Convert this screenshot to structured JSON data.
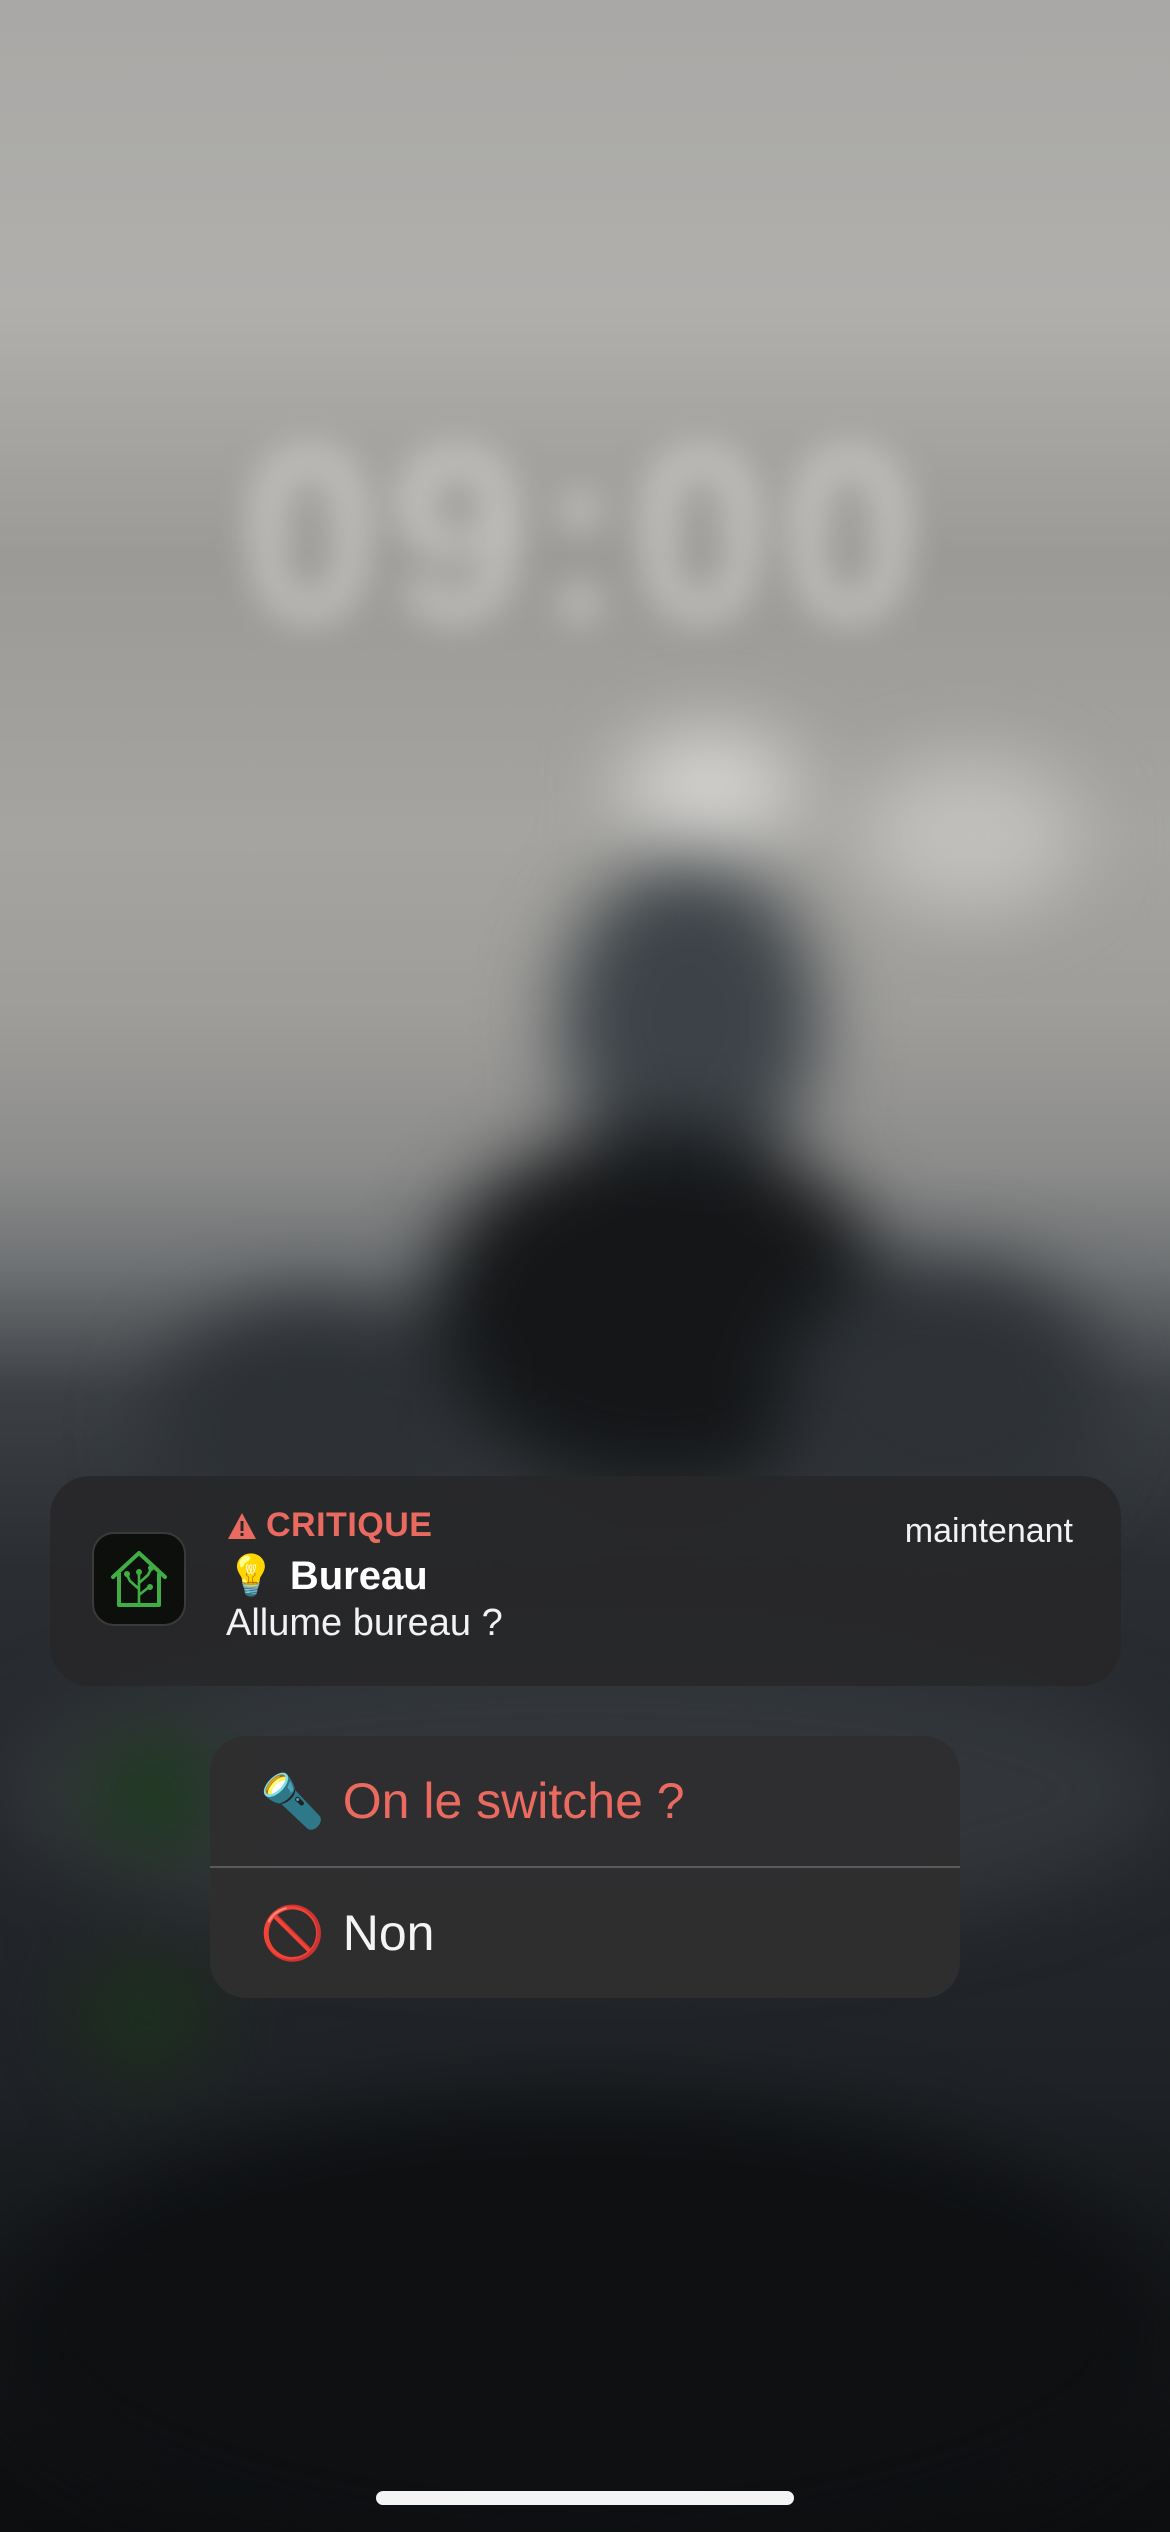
{
  "lock_screen": {
    "time": "09:00"
  },
  "notification": {
    "level": "CRITIQUE",
    "time": "maintenant",
    "title_emoji": "💡",
    "title": "Bureau",
    "body": "Allume bureau ?",
    "app_icon": "home-assistant-icon"
  },
  "actions": [
    {
      "emoji": "🔦",
      "label": "On le switche ?",
      "color": "#ea6a5f"
    },
    {
      "emoji": "🚫",
      "label": "Non",
      "color": "#f4f4f4"
    }
  ],
  "colors": {
    "critical": "#ea6a5f",
    "card": "#28282a"
  }
}
